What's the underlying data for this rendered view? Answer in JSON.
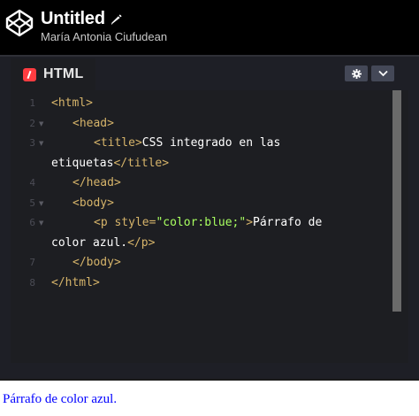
{
  "header": {
    "title": "Untitled",
    "author": "María Antonia Ciufudean",
    "logo_icon": "codepen-logo-icon",
    "edit_icon": "pencil-icon"
  },
  "editor": {
    "tab_label": "HTML",
    "settings_icon": "gear-icon",
    "collapse_icon": "chevron-down-icon",
    "line_numbers": [
      "1",
      "2",
      "3",
      "4",
      "5",
      "6",
      "7",
      "8"
    ],
    "lines": [
      {
        "tag_open": "<html>"
      },
      {
        "tag_open": "<head>"
      },
      {
        "tag_open": "<title>",
        "text": "CSS integrado en las"
      },
      {
        "text": "etiquetas",
        "tag_close": "</title>"
      },
      {
        "tag_close": "</head>"
      },
      {
        "tag_open": "<body>"
      },
      {
        "tag_start": "<p ",
        "attr": "style=",
        "str": "\"color:blue;\"",
        "tag_end": ">",
        "text": "Párrafo de"
      },
      {
        "text": "color azul.",
        "tag_close": "</p>"
      },
      {
        "tag_close": "</body>"
      },
      {
        "tag_close": "</html>"
      }
    ]
  },
  "preview": {
    "text": "Párrafo de color azul."
  },
  "colors": {
    "header_bg": "#000000",
    "editor_bg": "#1d1e22",
    "tag": "#d6b46a",
    "string": "#a8ff60",
    "preview_text": "#0000ff"
  }
}
